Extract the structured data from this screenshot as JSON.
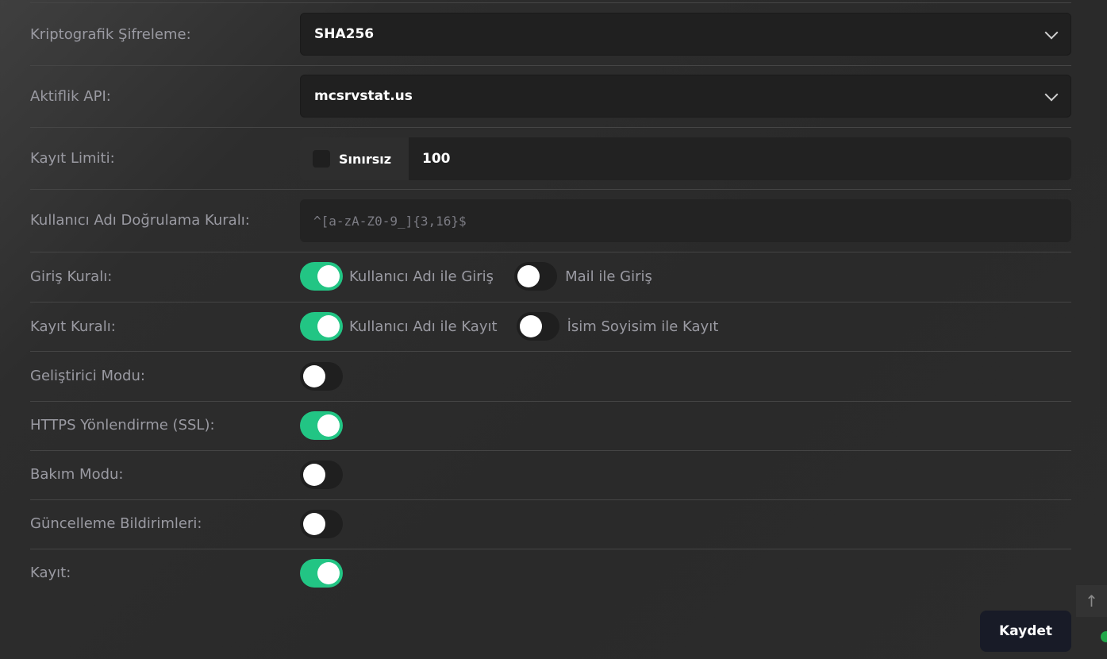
{
  "settings": {
    "crypto": {
      "label": "Kriptografik Şifreleme:",
      "value": "SHA256"
    },
    "activity_api": {
      "label": "Aktiflik API:",
      "value": "mcsrvstat.us"
    },
    "register_limit": {
      "label": "Kayıt Limiti:",
      "unlimited_label": "Sınırsız",
      "unlimited_checked": false,
      "value": "100"
    },
    "username_rule": {
      "label": "Kullanıcı Adı Doğrulama Kuralı:",
      "placeholder": "^[a-zA-Z0-9_]{3,16}$"
    },
    "login_rule": {
      "label": "Giriş Kuralı:",
      "options": [
        {
          "label": "Kullanıcı Adı ile Giriş",
          "on": true
        },
        {
          "label": "Mail ile Giriş",
          "on": false
        }
      ]
    },
    "register_rule": {
      "label": "Kayıt Kuralı:",
      "options": [
        {
          "label": "Kullanıcı Adı ile Kayıt",
          "on": true
        },
        {
          "label": "İsim Soyisim ile Kayıt",
          "on": false
        }
      ]
    },
    "developer_mode": {
      "label": "Geliştirici Modu:",
      "on": false
    },
    "https_redirect": {
      "label": "HTTPS Yönlendirme (SSL):",
      "on": true
    },
    "maintenance_mode": {
      "label": "Bakım Modu:",
      "on": false
    },
    "update_notifications": {
      "label": "Güncelleme Bildirimleri:",
      "on": false
    },
    "registration": {
      "label": "Kayıt:",
      "on": true
    }
  },
  "actions": {
    "save_label": "Kaydet"
  },
  "icons": {
    "scroll_top": "arrow-up-icon",
    "select_chevron": "chevron-down-icon"
  },
  "colors": {
    "toggle_on": "#22c584",
    "toggle_off": "#1f1f1f",
    "save_button": "#181b27"
  }
}
